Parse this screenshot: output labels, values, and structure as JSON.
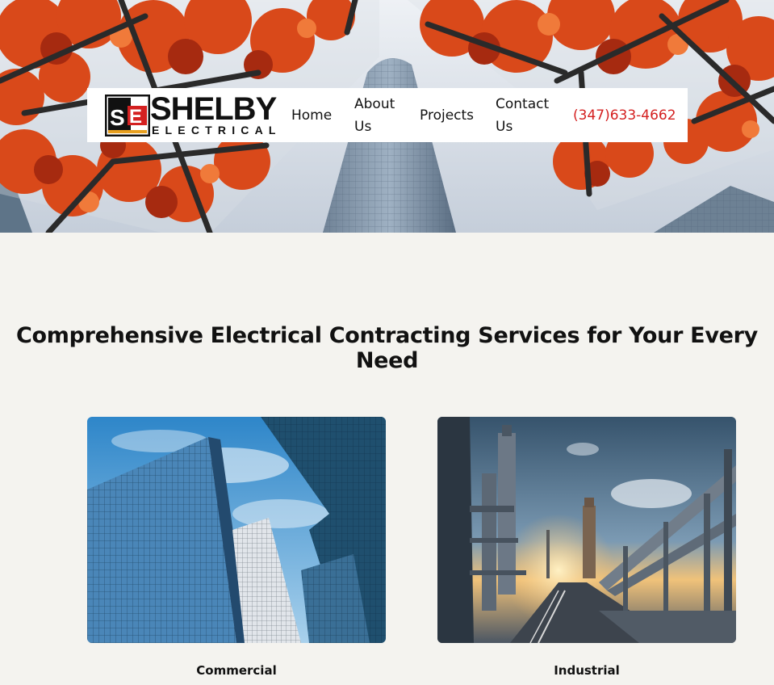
{
  "header": {
    "logo_mark_icon": "se-monogram-icon",
    "logo_word": "SHELBY",
    "logo_sub": "ELECTRICAL",
    "nav": {
      "home": "Home",
      "about_line1": "About",
      "about_line2": "Us",
      "projects": "Projects",
      "contact_line1": "Contact",
      "contact_line2": "Us",
      "phone": "(347)633-4662"
    }
  },
  "main": {
    "heading": "Comprehensive Electrical Contracting Services for Your Every Need",
    "services": [
      {
        "label": "Commercial"
      },
      {
        "label": "Industrial"
      }
    ]
  },
  "colors": {
    "page_bg": "#f4f3ef",
    "accent_red": "#d42020",
    "leaf_orange": "#d9491a",
    "text": "#111111"
  }
}
